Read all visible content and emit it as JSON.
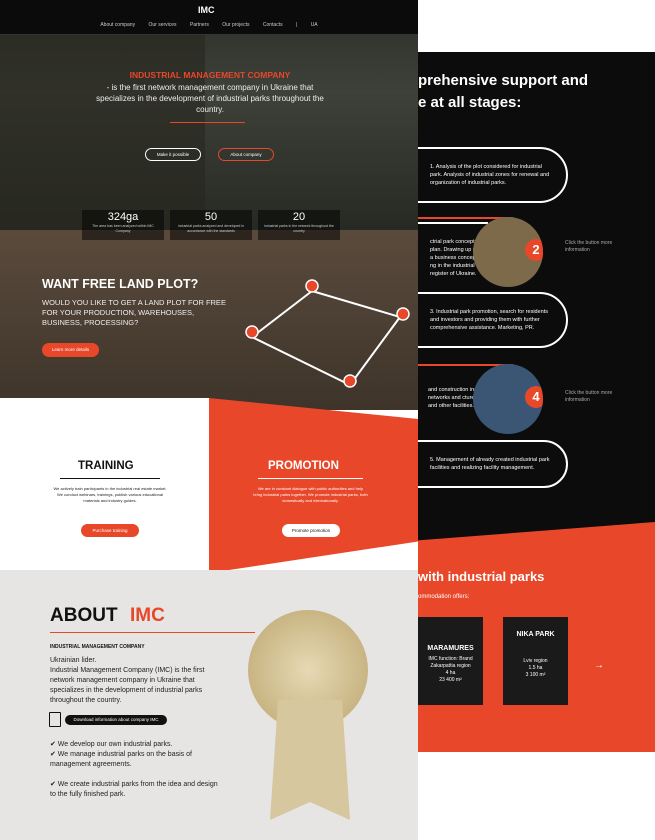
{
  "nav": {
    "logo": "IMC",
    "items": [
      "About company",
      "Our services",
      "Partners",
      "Our projects",
      "Contacts",
      "|",
      "UA"
    ]
  },
  "hero": {
    "title": "INDUSTRIAL MANAGEMENT COMPANY",
    "subtitle": "- is the first network management company in Ukraine that specializes in the development of industrial parks throughout the country.",
    "btn1": "Make it possible",
    "btn2": "About company"
  },
  "stats": [
    {
      "value": "324ga",
      "desc": "The area has been analyzed within IMC Company"
    },
    {
      "value": "50",
      "desc": "industrial parks analyzed and developed in accordance with the standards"
    },
    {
      "value": "20",
      "desc": "industrial parks in the network throughout the country"
    }
  ],
  "land": {
    "title": "WANT FREE LAND PLOT?",
    "subtitle": "WOULD YOU LIKE TO GET A LAND PLOT FOR FREE FOR YOUR PRODUCTION, WAREHOUSES, BUSINESS, PROCESSING?",
    "button": "Learn more details"
  },
  "training": {
    "title": "TRAINING",
    "desc": "We actively train participants in the industrial real estate market. We conduct webinars, trainings, publish various educational materials and industry guides.",
    "button": "Purchase training"
  },
  "promotion": {
    "title": "PROMOTION",
    "desc": "We are in constant dialogue with public authorities and help bring industrial parks together. We promote industrial parks, both domestically and internationally.",
    "button": "Promote promotion"
  },
  "about": {
    "title": "ABOUT",
    "brand": "IMC",
    "subtitle": "INDUSTRIAL MANAGEMENT COMPANY",
    "body": "Ukrainian lider.\nIndustrial Management Company (IMC) is the first network management company in Ukraine that specializes in the development of industrial parks throughout the country.",
    "download": "Download information about company IMC",
    "list": [
      "✔ We develop our own industrial parks.",
      "✔ We manage industrial parks on the basis of management agreements.",
      "",
      "✔ We create industrial parks from the idea and design to the fully finished park."
    ]
  },
  "right": {
    "heading1": "prehensive support and",
    "heading2": "e at all stages:",
    "steps": [
      "1. Analysis of the plot considered for industrial park. Analysis of industrial zones for renewal and organization of industrial parks.",
      "ctrial park concept plan. Drawing up of a business concept ng in the industrial register of Ukraine.",
      "3. Industrial park promotion, search for residents and investors and providing them with further comprehensive assistance. Marketing, PR.",
      "and construction ing networks and cture and other facilities.",
      "5. Management of already created industrial park facilities and realizing facility management."
    ],
    "click": "Click the button more information",
    "sec": "with industrial parks",
    "secSub": "ommodation offers:",
    "cards": [
      {
        "name": "MARAMURES",
        "body": "IMC function: Brand\nZakarpattia region\n4 ha\n23 400 m²"
      },
      {
        "name": "NIKA PARK",
        "body": "Lviv region\n1.5 ha\n3 100 m²"
      }
    ],
    "arrow": "→"
  }
}
